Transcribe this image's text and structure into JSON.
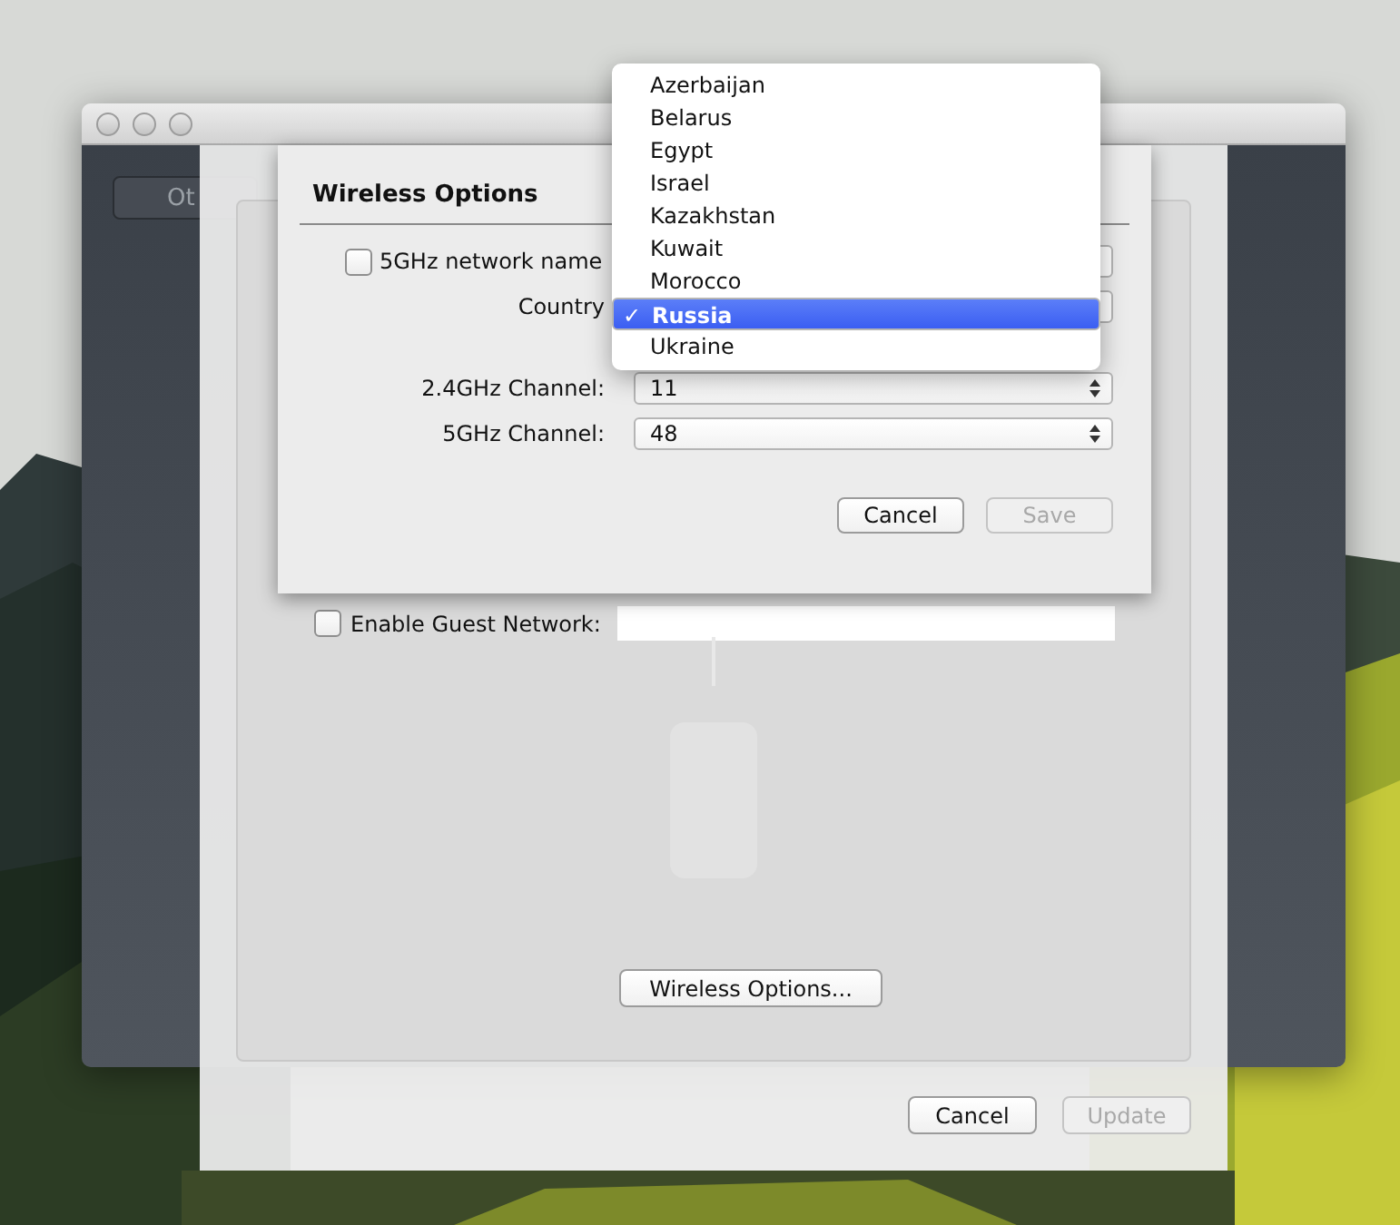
{
  "back_window": {
    "sidebar_button": "Ot"
  },
  "sheet": {
    "guest_network": {
      "label": "Enable Guest Network:",
      "checked": false
    },
    "wireless_options_button": "Wireless Options...",
    "buttons": [
      {
        "label": "Cancel",
        "disabled": false
      },
      {
        "label": "Update",
        "disabled": true
      }
    ]
  },
  "wireless_options": {
    "title": "Wireless Options",
    "fiveghz_name": {
      "label": "5GHz network name",
      "checked": false
    },
    "country_label": "Country",
    "channels": [
      {
        "label": "2.4GHz Channel:",
        "value": "11"
      },
      {
        "label": "5GHz Channel:",
        "value": "48"
      }
    ],
    "buttons": [
      {
        "label": "Cancel",
        "disabled": false
      },
      {
        "label": "Save",
        "disabled": true
      }
    ]
  },
  "country_menu": {
    "check_mark": "✓",
    "items": [
      {
        "label": "Azerbaijan",
        "selected": false
      },
      {
        "label": "Belarus",
        "selected": false
      },
      {
        "label": "Egypt",
        "selected": false
      },
      {
        "label": "Israel",
        "selected": false
      },
      {
        "label": "Kazakhstan",
        "selected": false
      },
      {
        "label": "Kuwait",
        "selected": false
      },
      {
        "label": "Morocco",
        "selected": false
      },
      {
        "label": "Russia",
        "selected": true
      },
      {
        "label": "Ukraine",
        "selected": false
      }
    ]
  }
}
